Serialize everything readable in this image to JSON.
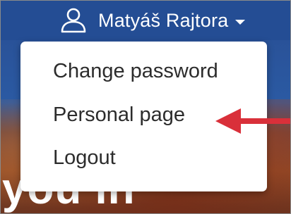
{
  "header": {
    "user_name": "Matyáš Rajtora",
    "user_icon": "user-icon",
    "caret_icon": "caret-down-icon"
  },
  "dropdown": {
    "items": [
      {
        "label": "Change password"
      },
      {
        "label": "Personal page"
      },
      {
        "label": "Logout"
      }
    ]
  },
  "background": {
    "partial_text": "you in"
  },
  "annotation": {
    "arrow_icon": "arrow-left-icon",
    "arrow_color": "#d9303a"
  },
  "colors": {
    "topbar": "#244d94",
    "menu_text": "#2c2c2c"
  }
}
